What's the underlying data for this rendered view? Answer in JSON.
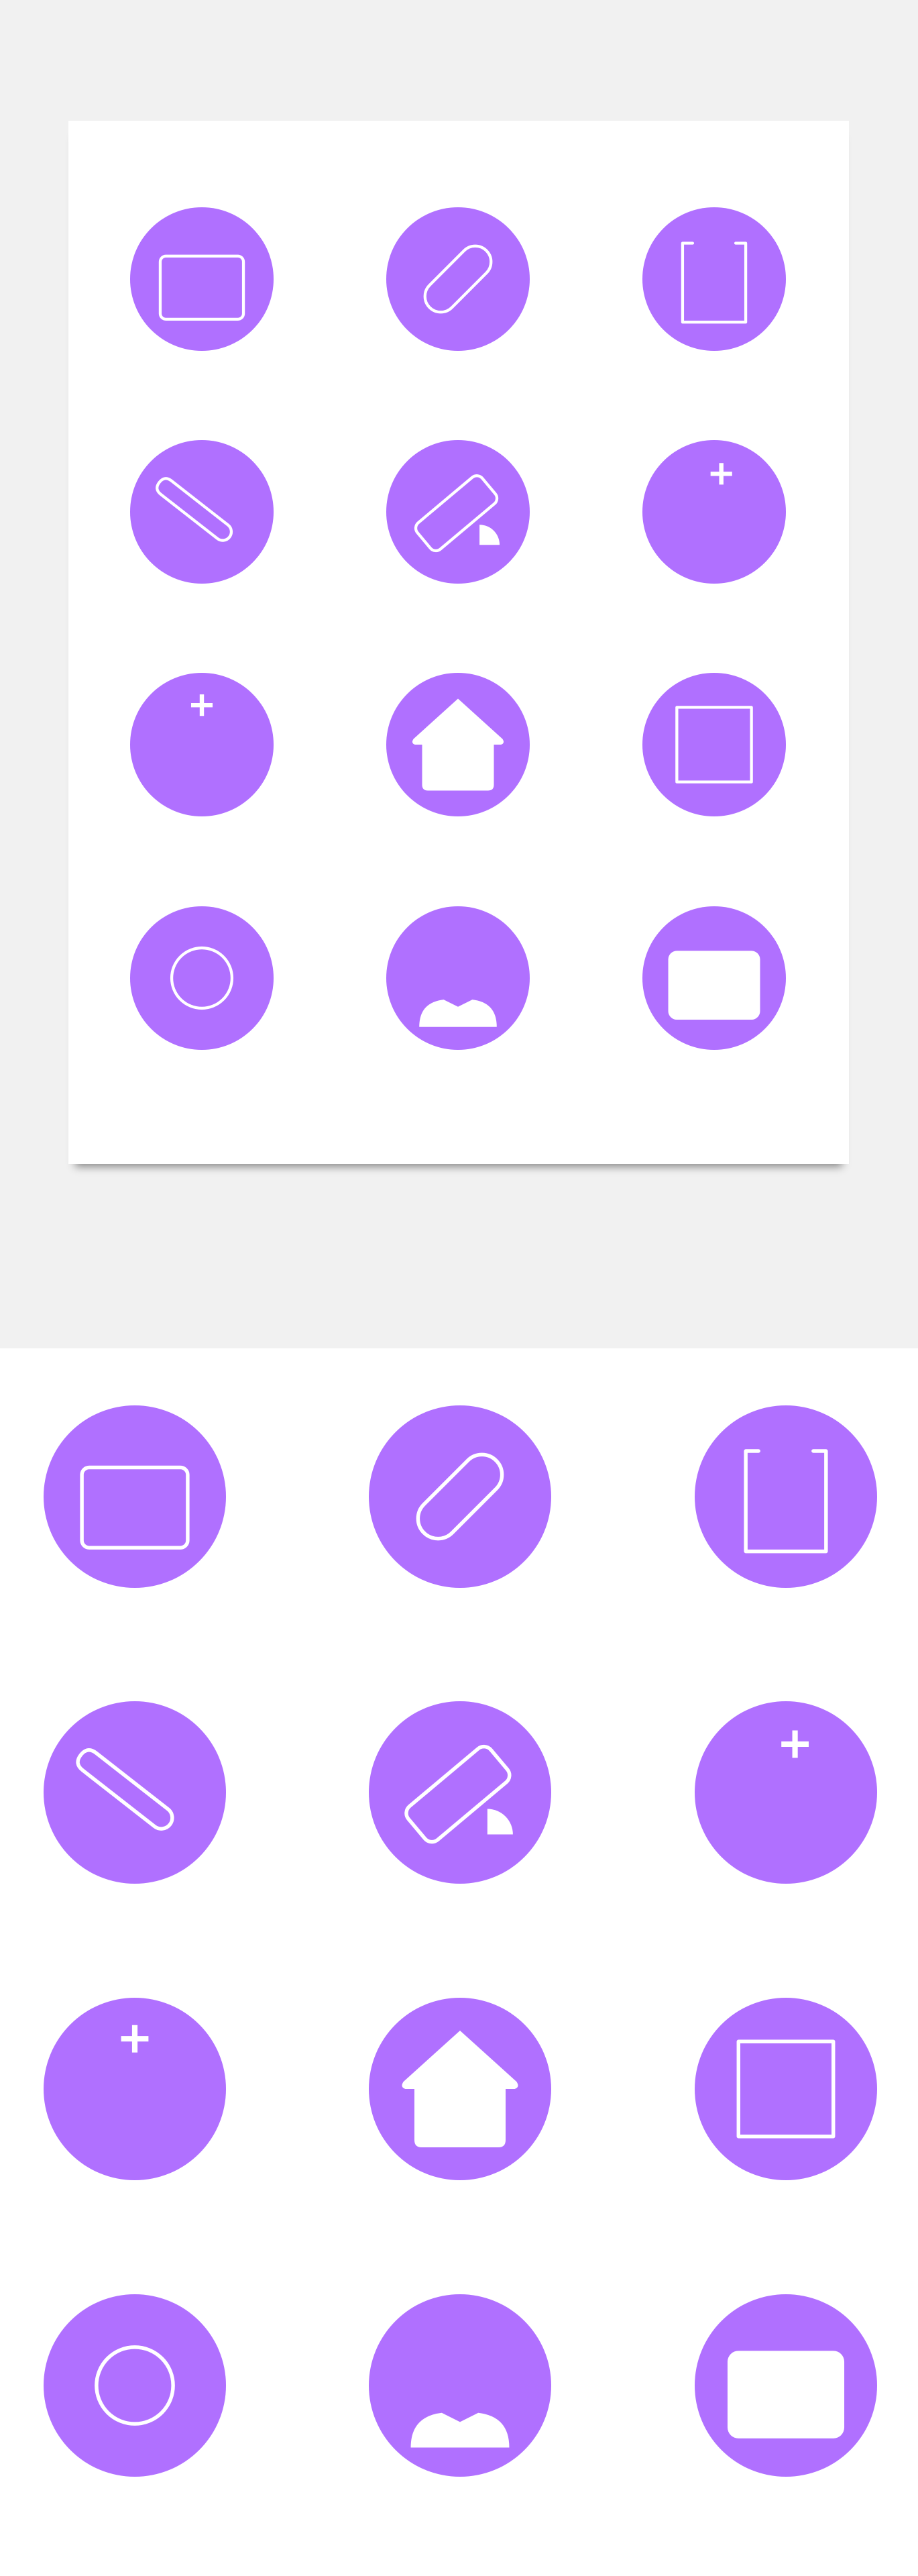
{
  "theme": {
    "accent_color": "#b070ff",
    "icon_color": "#ffffff",
    "top_background": "#f1f1f1",
    "card_background": "#ffffff",
    "bottom_background": "#ffffff"
  },
  "icons": [
    {
      "name": "first-aid-kit-outline-icon"
    },
    {
      "name": "pill-capsule-icon"
    },
    {
      "name": "medical-clipboard-icon"
    },
    {
      "name": "thermometer-icon"
    },
    {
      "name": "bandage-pill-icon"
    },
    {
      "name": "hospital-documents-icon"
    },
    {
      "name": "hospital-building-icon"
    },
    {
      "name": "home-health-icon"
    },
    {
      "name": "medical-calendar-icon"
    },
    {
      "name": "virus-icon"
    },
    {
      "name": "doctor-stethoscope-icon"
    },
    {
      "name": "first-aid-kit-solid-icon"
    }
  ]
}
